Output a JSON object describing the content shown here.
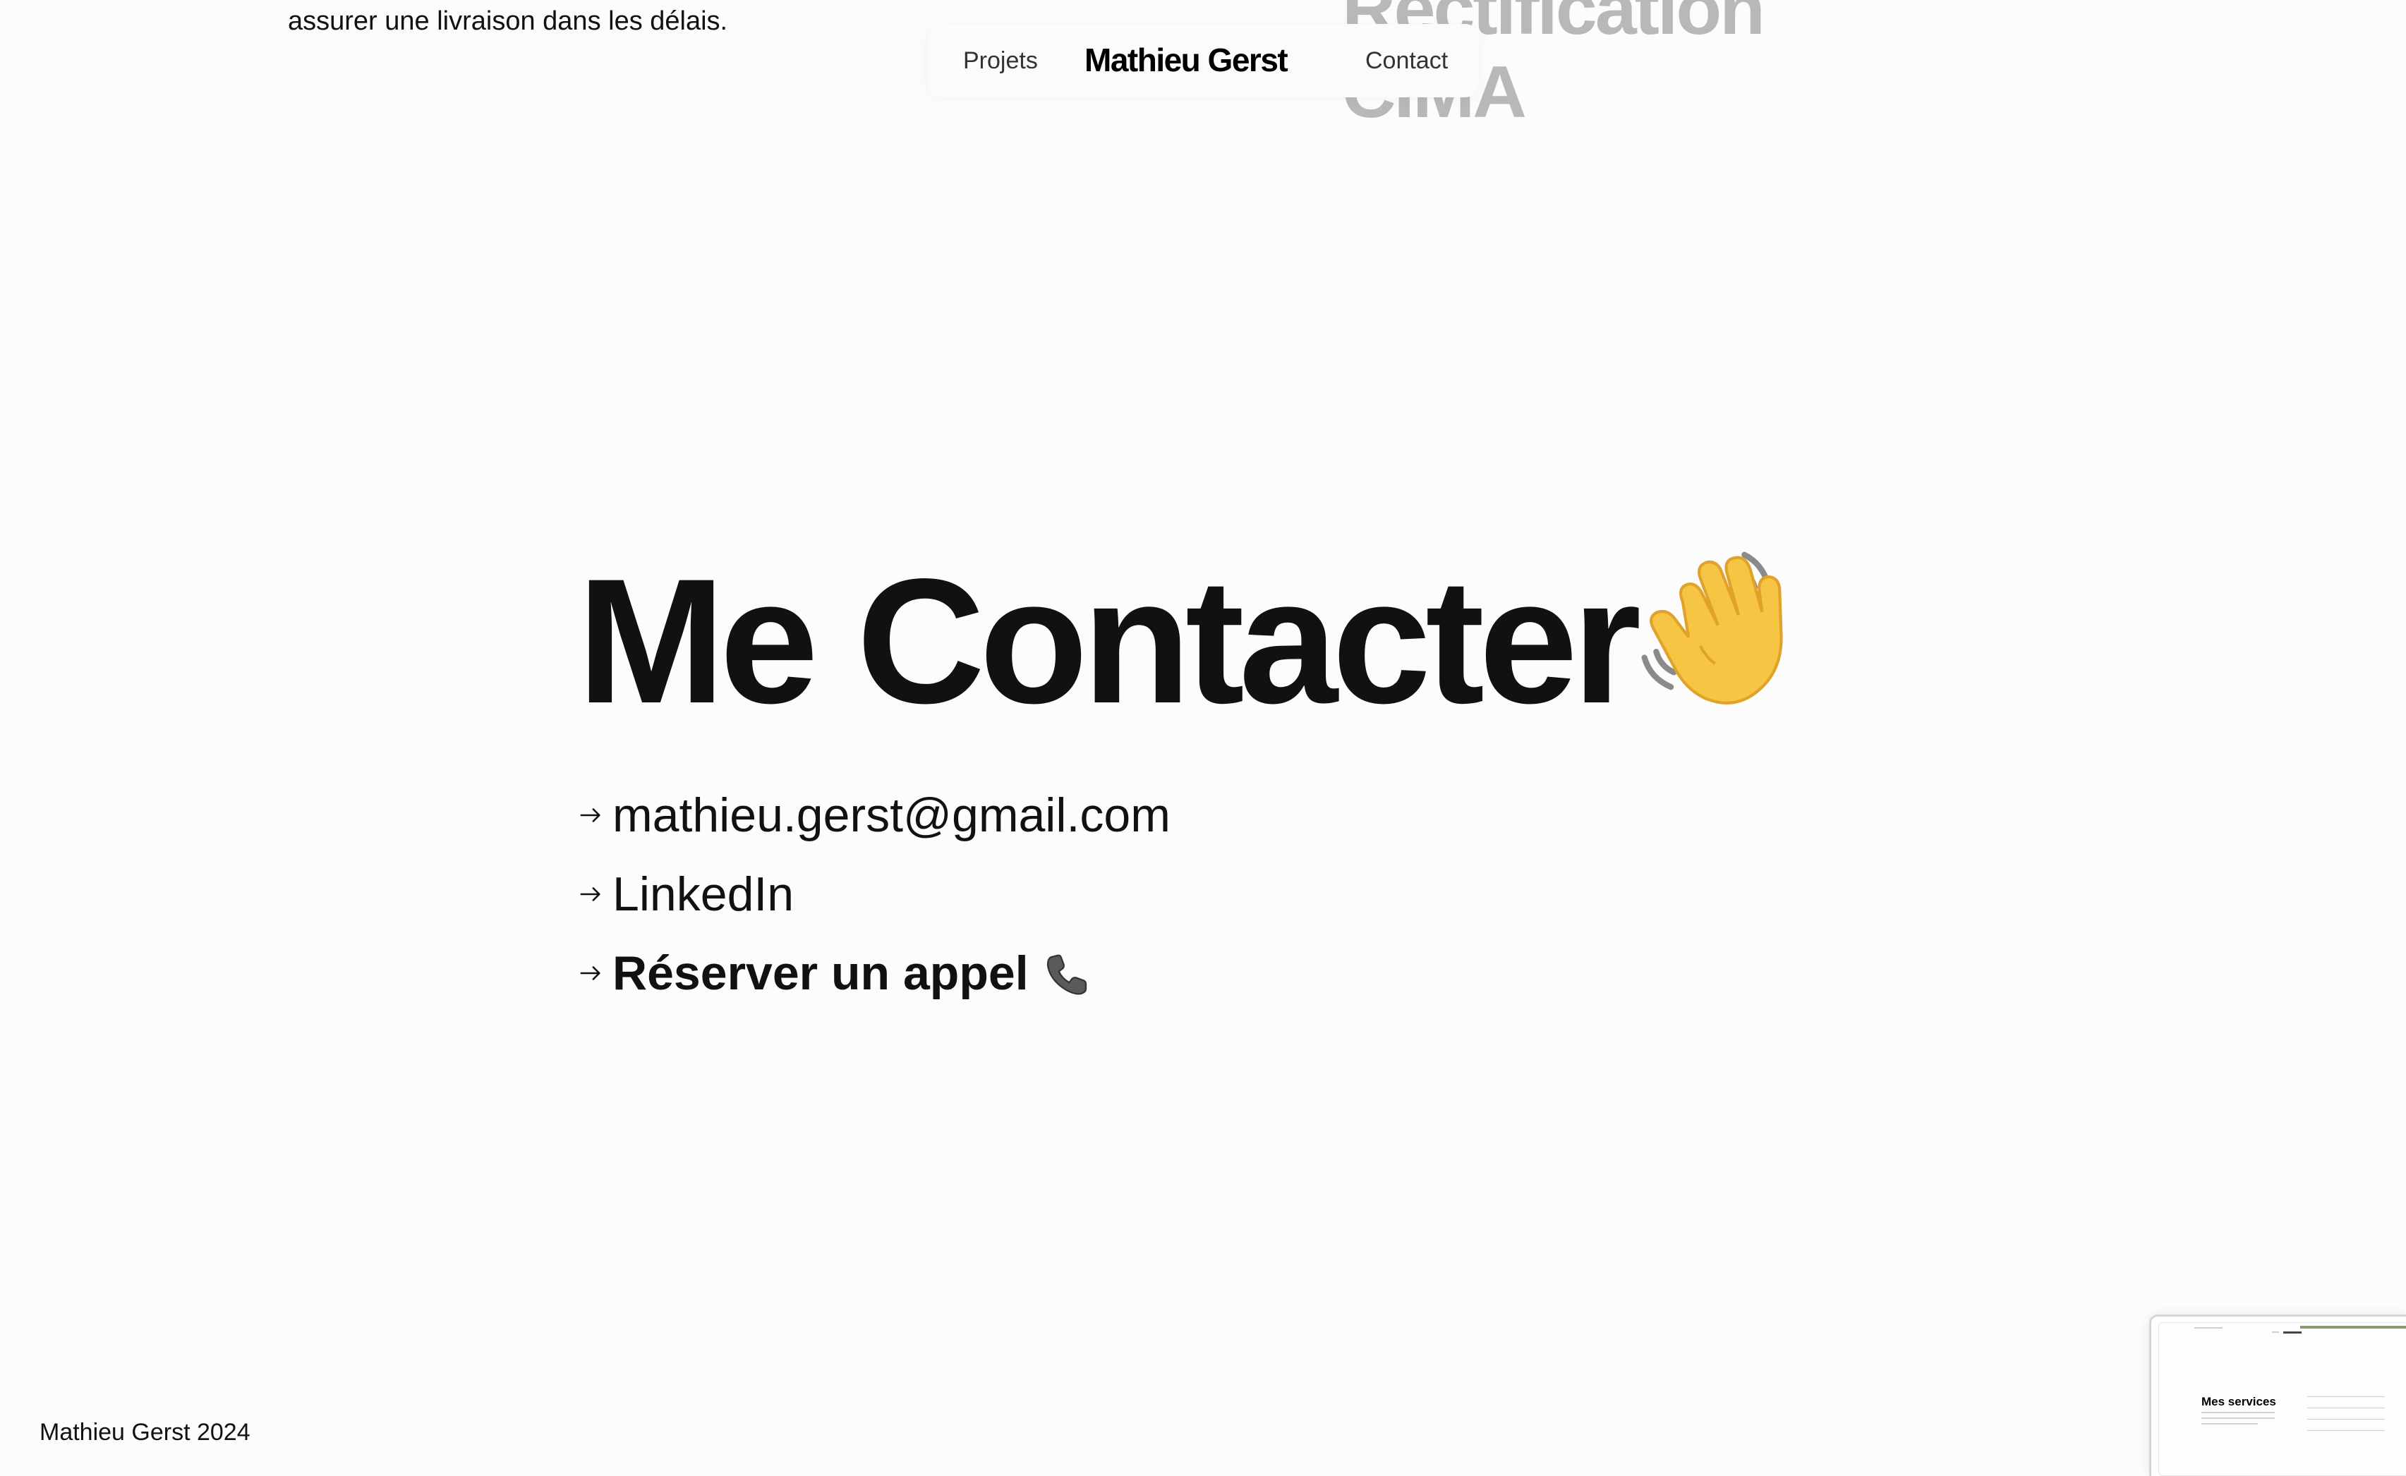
{
  "page": {
    "leftover_text": "assurer une livraison dans les délais.",
    "background_heading_line1": "Rectification",
    "background_heading_line2": "CIMA"
  },
  "nav": {
    "projects_label": "Projets",
    "brand": "Mathieu Gerst",
    "contact_label": "Contact"
  },
  "contact": {
    "title": "Me Contacter",
    "title_icon": "waving-hand-icon",
    "links": [
      {
        "label": "mathieu.gerst@gmail.com",
        "icon": "arrow-right-icon"
      },
      {
        "label": "LinkedIn",
        "icon": "arrow-right-icon"
      },
      {
        "label": "Réserver un appel",
        "icon": "arrow-right-icon",
        "trailing_icon": "telephone-icon"
      }
    ]
  },
  "footer": {
    "copyright": "Mathieu Gerst 2024"
  },
  "preview": {
    "heading": "Mes services"
  },
  "colors": {
    "background": "#fcfcfc",
    "text": "#111111",
    "muted_heading": "#b8b8b8",
    "nav_text": "#333333"
  }
}
